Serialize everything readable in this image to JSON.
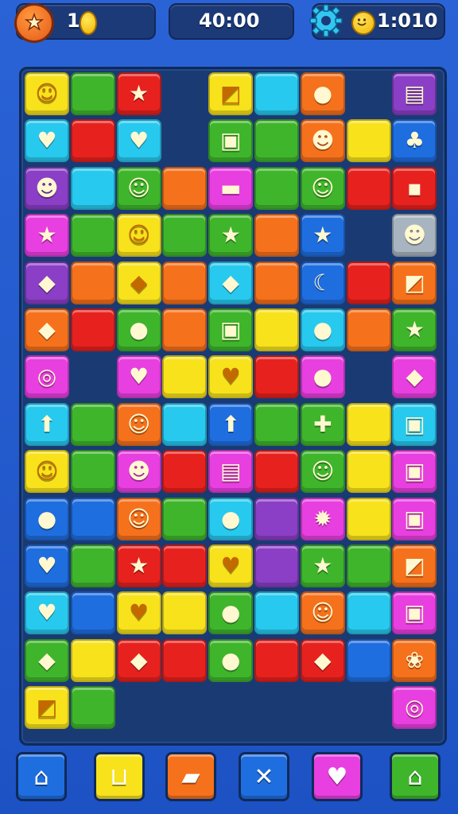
{
  "hud": {
    "coins_value": "1",
    "timer": "40:00",
    "score_value": "1:010",
    "wand_icon": "magic-wand-icon",
    "coin_icon": "coin-icon",
    "settings_icon": "gear-icon",
    "smiley_icon": "smiley-icon"
  },
  "colors": {
    "yellow": "#f7e21c",
    "green": "#3fb52c",
    "red": "#e7221e",
    "cyan": "#28c9ee",
    "orange": "#f6711c",
    "purple": "#8a3fc6",
    "magenta": "#e83fe0",
    "blue": "#1f6ee0",
    "lime": "#7fd12a",
    "gray": "#a8b4bf"
  },
  "board": {
    "tiles": [
      {
        "r": 0,
        "c": 0,
        "color": "yellow",
        "glyph": "☺",
        "name": "smiley-icon"
      },
      {
        "r": 0,
        "c": 1,
        "color": "green",
        "glyph": "",
        "name": "plain-tile"
      },
      {
        "r": 0,
        "c": 2,
        "color": "red",
        "glyph": "★",
        "name": "star-icon"
      },
      {
        "r": 0,
        "c": 4,
        "color": "yellow",
        "glyph": "◩",
        "name": "gem-icon"
      },
      {
        "r": 0,
        "c": 5,
        "color": "cyan",
        "glyph": "",
        "name": "plain-tile"
      },
      {
        "r": 0,
        "c": 6,
        "color": "orange",
        "glyph": "●",
        "name": "creature-icon"
      },
      {
        "r": 0,
        "c": 8,
        "color": "purple",
        "glyph": "▤",
        "name": "box-icon"
      },
      {
        "r": 1,
        "c": 0,
        "color": "cyan",
        "glyph": "♥",
        "name": "heart-icon"
      },
      {
        "r": 1,
        "c": 1,
        "color": "red",
        "glyph": "",
        "name": "plain-tile"
      },
      {
        "r": 1,
        "c": 2,
        "color": "cyan",
        "glyph": "♥",
        "name": "heart-icon"
      },
      {
        "r": 1,
        "c": 4,
        "color": "green",
        "glyph": "▣",
        "name": "box-icon"
      },
      {
        "r": 1,
        "c": 5,
        "color": "green",
        "glyph": "",
        "name": "plain-tile"
      },
      {
        "r": 1,
        "c": 6,
        "color": "orange",
        "glyph": "☻",
        "name": "face-icon"
      },
      {
        "r": 1,
        "c": 7,
        "color": "yellow",
        "glyph": "",
        "name": "plain-tile"
      },
      {
        "r": 1,
        "c": 8,
        "color": "blue",
        "glyph": "♣",
        "name": "cherry-icon"
      },
      {
        "r": 2,
        "c": 0,
        "color": "purple",
        "glyph": "☻",
        "name": "face-icon"
      },
      {
        "r": 2,
        "c": 1,
        "color": "cyan",
        "glyph": "",
        "name": "plain-tile"
      },
      {
        "r": 2,
        "c": 2,
        "color": "green",
        "glyph": "☺",
        "name": "smiley-icon"
      },
      {
        "r": 2,
        "c": 3,
        "color": "orange",
        "glyph": "",
        "name": "plain-tile"
      },
      {
        "r": 2,
        "c": 4,
        "color": "magenta",
        "glyph": "▬",
        "name": "badge-icon"
      },
      {
        "r": 2,
        "c": 5,
        "color": "green",
        "glyph": "",
        "name": "plain-tile"
      },
      {
        "r": 2,
        "c": 6,
        "color": "green",
        "glyph": "☺",
        "name": "smiley-icon"
      },
      {
        "r": 2,
        "c": 7,
        "color": "red",
        "glyph": "",
        "name": "plain-tile"
      },
      {
        "r": 2,
        "c": 8,
        "color": "red",
        "glyph": "▪",
        "name": "box-icon"
      },
      {
        "r": 3,
        "c": 0,
        "color": "magenta",
        "glyph": "★",
        "name": "star-icon"
      },
      {
        "r": 3,
        "c": 1,
        "color": "green",
        "glyph": "",
        "name": "plain-tile"
      },
      {
        "r": 3,
        "c": 2,
        "color": "yellow",
        "glyph": "☺",
        "name": "smiley-icon"
      },
      {
        "r": 3,
        "c": 3,
        "color": "green",
        "glyph": "",
        "name": "plain-tile"
      },
      {
        "r": 3,
        "c": 4,
        "color": "green",
        "glyph": "★",
        "name": "star-icon"
      },
      {
        "r": 3,
        "c": 5,
        "color": "orange",
        "glyph": "",
        "name": "plain-tile"
      },
      {
        "r": 3,
        "c": 6,
        "color": "blue",
        "glyph": "★",
        "name": "star-icon"
      },
      {
        "r": 3,
        "c": 8,
        "color": "gray",
        "glyph": "☻",
        "name": "face-icon"
      },
      {
        "r": 4,
        "c": 0,
        "color": "purple",
        "glyph": "◆",
        "name": "gem-icon"
      },
      {
        "r": 4,
        "c": 1,
        "color": "orange",
        "glyph": "",
        "name": "plain-tile"
      },
      {
        "r": 4,
        "c": 2,
        "color": "yellow",
        "glyph": "◆",
        "name": "gem-icon"
      },
      {
        "r": 4,
        "c": 3,
        "color": "orange",
        "glyph": "",
        "name": "plain-tile"
      },
      {
        "r": 4,
        "c": 4,
        "color": "cyan",
        "glyph": "◆",
        "name": "leaf-icon"
      },
      {
        "r": 4,
        "c": 5,
        "color": "orange",
        "glyph": "",
        "name": "plain-tile"
      },
      {
        "r": 4,
        "c": 6,
        "color": "blue",
        "glyph": "☾",
        "name": "banana-icon"
      },
      {
        "r": 4,
        "c": 7,
        "color": "red",
        "glyph": "",
        "name": "plain-tile"
      },
      {
        "r": 4,
        "c": 8,
        "color": "orange",
        "glyph": "◩",
        "name": "gem-icon"
      },
      {
        "r": 5,
        "c": 0,
        "color": "orange",
        "glyph": "◆",
        "name": "leaf-icon"
      },
      {
        "r": 5,
        "c": 1,
        "color": "red",
        "glyph": "",
        "name": "plain-tile"
      },
      {
        "r": 5,
        "c": 2,
        "color": "green",
        "glyph": "●",
        "name": "plum-icon"
      },
      {
        "r": 5,
        "c": 3,
        "color": "orange",
        "glyph": "",
        "name": "plain-tile"
      },
      {
        "r": 5,
        "c": 4,
        "color": "green",
        "glyph": "▣",
        "name": "box-icon"
      },
      {
        "r": 5,
        "c": 5,
        "color": "yellow",
        "glyph": "",
        "name": "plain-tile"
      },
      {
        "r": 5,
        "c": 6,
        "color": "cyan",
        "glyph": "●",
        "name": "ball-icon"
      },
      {
        "r": 5,
        "c": 7,
        "color": "orange",
        "glyph": "",
        "name": "plain-tile"
      },
      {
        "r": 5,
        "c": 8,
        "color": "green",
        "glyph": "★",
        "name": "star-icon"
      },
      {
        "r": 6,
        "c": 0,
        "color": "magenta",
        "glyph": "◎",
        "name": "swirl-icon"
      },
      {
        "r": 6,
        "c": 2,
        "color": "magenta",
        "glyph": "♥",
        "name": "heart-icon"
      },
      {
        "r": 6,
        "c": 3,
        "color": "yellow",
        "glyph": "",
        "name": "plain-tile"
      },
      {
        "r": 6,
        "c": 4,
        "color": "yellow",
        "glyph": "♥",
        "name": "heart-icon"
      },
      {
        "r": 6,
        "c": 5,
        "color": "red",
        "glyph": "",
        "name": "plain-tile"
      },
      {
        "r": 6,
        "c": 6,
        "color": "magenta",
        "glyph": "●",
        "name": "plum-icon"
      },
      {
        "r": 6,
        "c": 8,
        "color": "magenta",
        "glyph": "◆",
        "name": "candy-icon"
      },
      {
        "r": 7,
        "c": 0,
        "color": "cyan",
        "glyph": "⬆",
        "name": "arrow-icon"
      },
      {
        "r": 7,
        "c": 1,
        "color": "green",
        "glyph": "",
        "name": "plain-tile"
      },
      {
        "r": 7,
        "c": 2,
        "color": "orange",
        "glyph": "☺",
        "name": "smiley-icon"
      },
      {
        "r": 7,
        "c": 3,
        "color": "cyan",
        "glyph": "",
        "name": "plain-tile"
      },
      {
        "r": 7,
        "c": 4,
        "color": "blue",
        "glyph": "⬆",
        "name": "arrow-icon"
      },
      {
        "r": 7,
        "c": 5,
        "color": "green",
        "glyph": "",
        "name": "plain-tile"
      },
      {
        "r": 7,
        "c": 6,
        "color": "green",
        "glyph": "✚",
        "name": "melon-icon"
      },
      {
        "r": 7,
        "c": 7,
        "color": "yellow",
        "glyph": "",
        "name": "plain-tile"
      },
      {
        "r": 7,
        "c": 8,
        "color": "cyan",
        "glyph": "▣",
        "name": "box-icon"
      },
      {
        "r": 8,
        "c": 0,
        "color": "yellow",
        "glyph": "☺",
        "name": "smiley-icon"
      },
      {
        "r": 8,
        "c": 1,
        "color": "green",
        "glyph": "",
        "name": "plain-tile"
      },
      {
        "r": 8,
        "c": 2,
        "color": "magenta",
        "glyph": "☻",
        "name": "face-icon"
      },
      {
        "r": 8,
        "c": 3,
        "color": "red",
        "glyph": "",
        "name": "plain-tile"
      },
      {
        "r": 8,
        "c": 4,
        "color": "magenta",
        "glyph": "▤",
        "name": "box-icon"
      },
      {
        "r": 8,
        "c": 5,
        "color": "red",
        "glyph": "",
        "name": "plain-tile"
      },
      {
        "r": 8,
        "c": 6,
        "color": "green",
        "glyph": "☺",
        "name": "smiley-icon"
      },
      {
        "r": 8,
        "c": 7,
        "color": "yellow",
        "glyph": "",
        "name": "plain-tile"
      },
      {
        "r": 8,
        "c": 8,
        "color": "magenta",
        "glyph": "▣",
        "name": "box-icon"
      },
      {
        "r": 9,
        "c": 0,
        "color": "blue",
        "glyph": "●",
        "name": "ball-icon"
      },
      {
        "r": 9,
        "c": 1,
        "color": "blue",
        "glyph": "",
        "name": "plain-tile"
      },
      {
        "r": 9,
        "c": 2,
        "color": "orange",
        "glyph": "☺",
        "name": "smiley-icon"
      },
      {
        "r": 9,
        "c": 3,
        "color": "green",
        "glyph": "",
        "name": "plain-tile"
      },
      {
        "r": 9,
        "c": 4,
        "color": "cyan",
        "glyph": "●",
        "name": "ball-icon"
      },
      {
        "r": 9,
        "c": 5,
        "color": "purple",
        "glyph": "",
        "name": "plain-tile"
      },
      {
        "r": 9,
        "c": 6,
        "color": "magenta",
        "glyph": "✹",
        "name": "sun-icon"
      },
      {
        "r": 9,
        "c": 7,
        "color": "yellow",
        "glyph": "",
        "name": "plain-tile"
      },
      {
        "r": 9,
        "c": 8,
        "color": "magenta",
        "glyph": "▣",
        "name": "box-icon"
      },
      {
        "r": 10,
        "c": 0,
        "color": "blue",
        "glyph": "♥",
        "name": "heart-icon"
      },
      {
        "r": 10,
        "c": 1,
        "color": "green",
        "glyph": "",
        "name": "plain-tile"
      },
      {
        "r": 10,
        "c": 2,
        "color": "red",
        "glyph": "★",
        "name": "star-icon"
      },
      {
        "r": 10,
        "c": 3,
        "color": "red",
        "glyph": "",
        "name": "plain-tile"
      },
      {
        "r": 10,
        "c": 4,
        "color": "yellow",
        "glyph": "♥",
        "name": "heart-icon"
      },
      {
        "r": 10,
        "c": 5,
        "color": "purple",
        "glyph": "",
        "name": "plain-tile"
      },
      {
        "r": 10,
        "c": 6,
        "color": "green",
        "glyph": "★",
        "name": "star-icon"
      },
      {
        "r": 10,
        "c": 7,
        "color": "green",
        "glyph": "",
        "name": "plain-tile"
      },
      {
        "r": 10,
        "c": 8,
        "color": "orange",
        "glyph": "◩",
        "name": "gem-icon"
      },
      {
        "r": 11,
        "c": 0,
        "color": "cyan",
        "glyph": "♥",
        "name": "heart-icon"
      },
      {
        "r": 11,
        "c": 1,
        "color": "blue",
        "glyph": "",
        "name": "plain-tile"
      },
      {
        "r": 11,
        "c": 2,
        "color": "yellow",
        "glyph": "♥",
        "name": "heart-icon"
      },
      {
        "r": 11,
        "c": 3,
        "color": "yellow",
        "glyph": "",
        "name": "plain-tile"
      },
      {
        "r": 11,
        "c": 4,
        "color": "green",
        "glyph": "●",
        "name": "ball-icon"
      },
      {
        "r": 11,
        "c": 5,
        "color": "cyan",
        "glyph": "",
        "name": "plain-tile"
      },
      {
        "r": 11,
        "c": 6,
        "color": "orange",
        "glyph": "☺",
        "name": "smiley-icon"
      },
      {
        "r": 11,
        "c": 7,
        "color": "cyan",
        "glyph": "",
        "name": "plain-tile"
      },
      {
        "r": 11,
        "c": 8,
        "color": "magenta",
        "glyph": "▣",
        "name": "box-icon"
      },
      {
        "r": 12,
        "c": 0,
        "color": "green",
        "glyph": "◆",
        "name": "leaf-icon"
      },
      {
        "r": 12,
        "c": 1,
        "color": "yellow",
        "glyph": "",
        "name": "plain-tile"
      },
      {
        "r": 12,
        "c": 2,
        "color": "red",
        "glyph": "◆",
        "name": "gem-icon"
      },
      {
        "r": 12,
        "c": 3,
        "color": "red",
        "glyph": "",
        "name": "plain-tile"
      },
      {
        "r": 12,
        "c": 4,
        "color": "green",
        "glyph": "●",
        "name": "apple-icon"
      },
      {
        "r": 12,
        "c": 5,
        "color": "red",
        "glyph": "",
        "name": "plain-tile"
      },
      {
        "r": 12,
        "c": 6,
        "color": "red",
        "glyph": "◆",
        "name": "gem-icon"
      },
      {
        "r": 12,
        "c": 7,
        "color": "blue",
        "glyph": "",
        "name": "plain-tile"
      },
      {
        "r": 12,
        "c": 8,
        "color": "orange",
        "glyph": "❀",
        "name": "leaf-icon"
      },
      {
        "r": 13,
        "c": 0,
        "color": "yellow",
        "glyph": "◩",
        "name": "gem-icon"
      },
      {
        "r": 13,
        "c": 1,
        "color": "green",
        "glyph": "",
        "name": "plain-tile"
      },
      {
        "r": 13,
        "c": 8,
        "color": "magenta",
        "glyph": "◎",
        "name": "swirl-icon"
      }
    ]
  },
  "toolbar": {
    "buttons": [
      {
        "name": "home-button",
        "icon": "⌂",
        "icon_name": "home-icon",
        "color": "blue"
      },
      {
        "name": "stats-button",
        "icon": "⊔",
        "icon_name": "chart-icon",
        "color": "yellow"
      },
      {
        "name": "cards-button",
        "icon": "▰",
        "icon_name": "card-icon",
        "color": "orange"
      },
      {
        "name": "tools-button",
        "icon": "✕",
        "icon_name": "tools-icon",
        "color": "blue"
      },
      {
        "name": "favorite-button",
        "icon": "♥",
        "icon_name": "heart-icon",
        "color": "magenta"
      },
      {
        "name": "exit-button",
        "icon": "⌂",
        "icon_name": "house-exit-icon",
        "color": "green"
      }
    ]
  }
}
